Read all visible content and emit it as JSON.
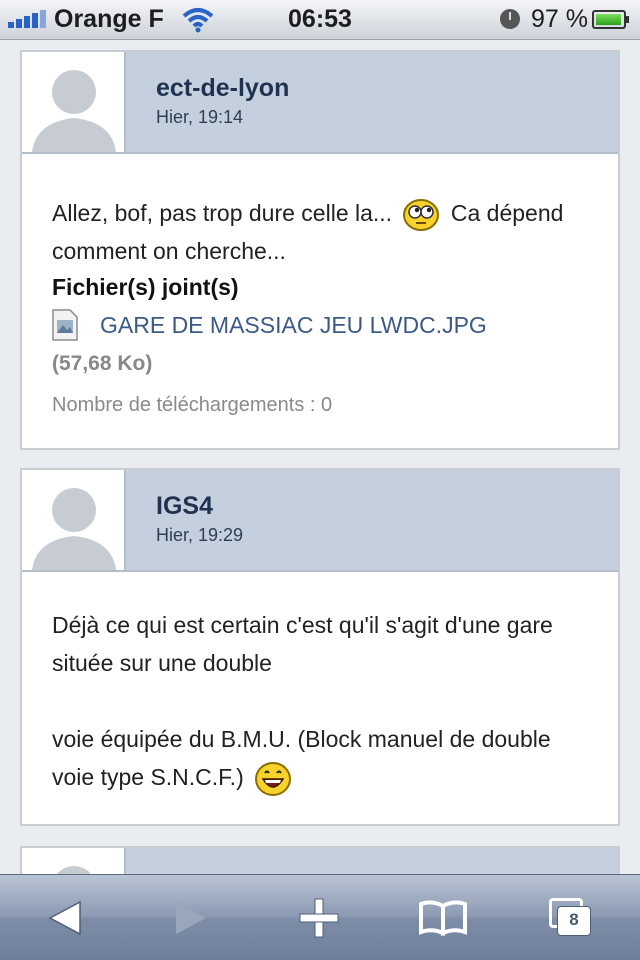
{
  "status_bar": {
    "carrier": "Orange F",
    "time": "06:53",
    "battery": "97 %",
    "battery_level": 0.97
  },
  "posts": [
    {
      "author": "ect-de-lyon",
      "date": "Hier, 19:14",
      "text_before_smiley": "Allez, bof, pas trop dure celle la...",
      "text_after_smiley": "Ca dépend comment on cherche...",
      "smiley": "rolling-eyes-smiley",
      "attachments_title": "Fichier(s) joint(s)",
      "attachment": {
        "name": "GARE DE MASSIAC JEU LWDC.JPG",
        "size": "(57,68 Ko)",
        "downloads": "Nombre de téléchargements : 0"
      }
    },
    {
      "author": "IGS4",
      "date": "Hier, 19:29",
      "paragraph_1": "Déjà ce qui est certain c'est qu'il s'agit d'une gare située sur une double",
      "paragraph_2": "voie équipée du B.M.U. (Block manuel de double voie type S.N.C.F.)",
      "smiley": "laughing-smiley"
    }
  ],
  "toolbar": {
    "back": "back-icon",
    "forward": "forward-icon",
    "add": "add-icon",
    "bookmarks": "bookmarks-icon",
    "tabs": "tabs-icon",
    "tab_count": "8"
  },
  "colors": {
    "header_bg": "#c5d0de",
    "link": "#3b5a86",
    "author": "#1f3350"
  }
}
